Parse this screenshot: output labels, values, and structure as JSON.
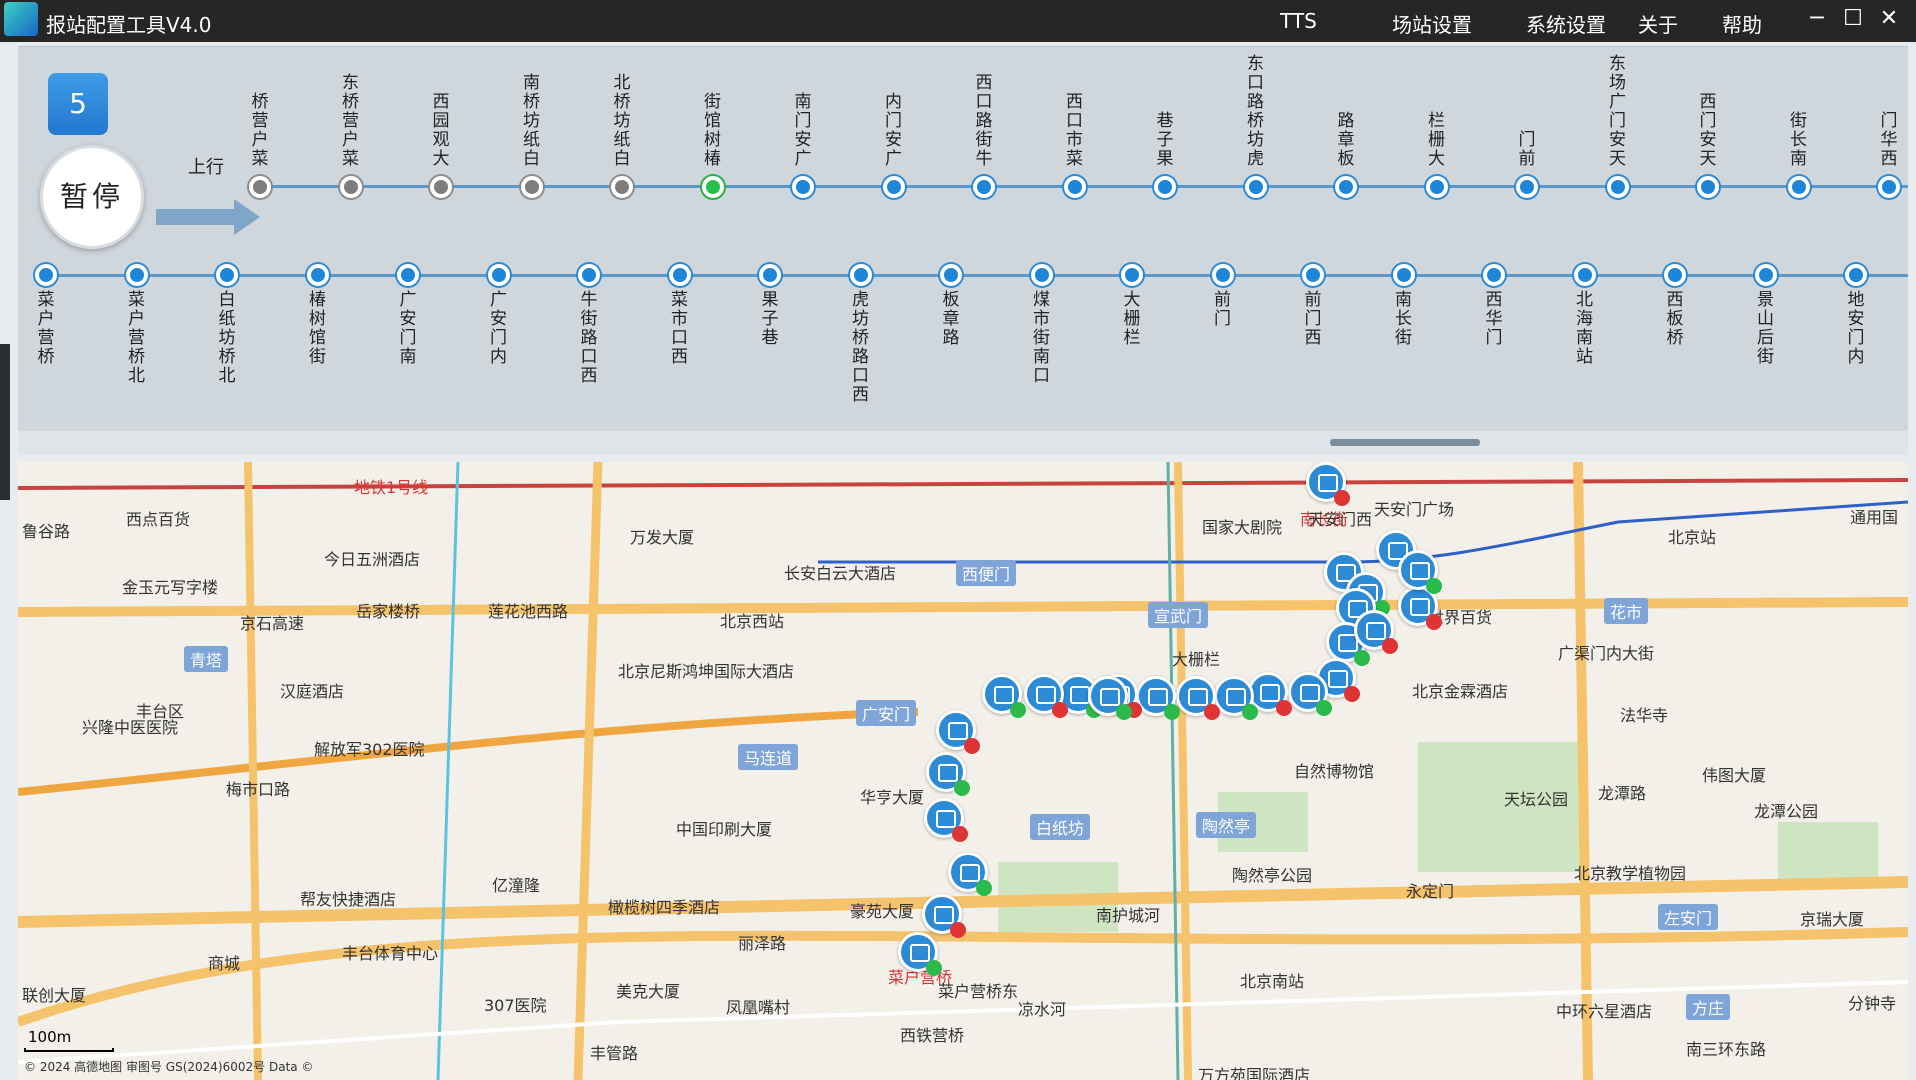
{
  "app": {
    "title": "报站配置工具V4.0"
  },
  "menu": {
    "tts": "TTS",
    "station": "场站设置",
    "system": "系统设置",
    "about": "关于",
    "help": "帮助"
  },
  "window": {
    "minimize": "─",
    "maximize": "☐",
    "close": "✕"
  },
  "route": {
    "number": "5",
    "pause_label": "暂停",
    "direction": "上行"
  },
  "upper_stations": [
    {
      "name": "桥营户菜",
      "state": "grey"
    },
    {
      "name": "东桥营户菜",
      "state": "grey"
    },
    {
      "name": "西园观大",
      "state": "grey"
    },
    {
      "name": "南桥坊纸白",
      "state": "grey"
    },
    {
      "name": "北桥坊纸白",
      "state": "grey"
    },
    {
      "name": "街馆树椿",
      "state": "current"
    },
    {
      "name": "南门安广",
      "state": "blue"
    },
    {
      "name": "内门安广",
      "state": "blue"
    },
    {
      "name": "西口路街牛",
      "state": "blue"
    },
    {
      "name": "西口市菜",
      "state": "blue"
    },
    {
      "name": "巷子果",
      "state": "blue"
    },
    {
      "name": "东口路桥坊虎",
      "state": "blue"
    },
    {
      "name": "路章板",
      "state": "blue"
    },
    {
      "name": "栏栅大",
      "state": "blue"
    },
    {
      "name": "门前",
      "state": "blue"
    },
    {
      "name": "东场广门安天",
      "state": "blue"
    },
    {
      "name": "西门安天",
      "state": "blue"
    },
    {
      "name": "街长南",
      "state": "blue"
    },
    {
      "name": "门华西",
      "state": "blue"
    }
  ],
  "lower_stations": [
    "菜户营桥",
    "菜户营桥北",
    "白纸坊桥北",
    "椿树馆街",
    "广安门南",
    "广安门内",
    "牛街路口西",
    "菜市口西",
    "果子巷",
    "虎坊桥路口西",
    "板章路",
    "煤市街南口",
    "大栅栏",
    "前门",
    "前门西",
    "南长街",
    "西华门",
    "北海南站",
    "西板桥",
    "景山后街",
    "地安门内"
  ],
  "map": {
    "labels": [
      {
        "text": "地铁1号线",
        "style": "red"
      },
      {
        "text": "西点百货",
        "style": ""
      },
      {
        "text": "鲁谷路",
        "style": ""
      },
      {
        "text": "万发大厦",
        "style": ""
      },
      {
        "text": "今日五洲酒店",
        "style": ""
      },
      {
        "text": "金玉元写字楼",
        "style": ""
      },
      {
        "text": "长安白云大酒店",
        "style": ""
      },
      {
        "text": "西便门",
        "style": "bluebox"
      },
      {
        "text": "国家大剧院",
        "style": ""
      },
      {
        "text": "天安门广场",
        "style": ""
      },
      {
        "text": "北京站",
        "style": ""
      },
      {
        "text": "通用国",
        "style": ""
      },
      {
        "text": "京石高速",
        "style": ""
      },
      {
        "text": "岳家楼桥",
        "style": ""
      },
      {
        "text": "莲花池西路",
        "style": ""
      },
      {
        "text": "北京西站",
        "style": ""
      },
      {
        "text": "宣武门",
        "style": "bluebox"
      },
      {
        "text": "新世界百货",
        "style": ""
      },
      {
        "text": "花市",
        "style": "bluebox"
      },
      {
        "text": "青塔",
        "style": "bluebox"
      },
      {
        "text": "北京尼斯鸿坤国际大酒店",
        "style": ""
      },
      {
        "text": "广渠门内大街",
        "style": ""
      },
      {
        "text": "汉庭酒店",
        "style": ""
      },
      {
        "text": "丰台区",
        "style": ""
      },
      {
        "text": "兴隆中医医院",
        "style": ""
      },
      {
        "text": "广安门",
        "style": "bluebox"
      },
      {
        "text": "北京金霖酒店",
        "style": ""
      },
      {
        "text": "法华寺",
        "style": ""
      },
      {
        "text": "解放军302医院",
        "style": ""
      },
      {
        "text": "马连道",
        "style": "bluebox"
      },
      {
        "text": "自然博物馆",
        "style": ""
      },
      {
        "text": "伟图大厦",
        "style": ""
      },
      {
        "text": "梅市口路",
        "style": ""
      },
      {
        "text": "华亨大厦",
        "style": ""
      },
      {
        "text": "天坛公园",
        "style": ""
      },
      {
        "text": "龙潭路",
        "style": ""
      },
      {
        "text": "中国印刷大厦",
        "style": ""
      },
      {
        "text": "白纸坊",
        "style": "bluebox"
      },
      {
        "text": "陶然亭",
        "style": "bluebox"
      },
      {
        "text": "龙潭公园",
        "style": ""
      },
      {
        "text": "亿潼隆",
        "style": ""
      },
      {
        "text": "陶然亭公园",
        "style": ""
      },
      {
        "text": "北京教学植物园",
        "style": ""
      },
      {
        "text": "帮友快捷酒店",
        "style": ""
      },
      {
        "text": "橄榄树四季酒店",
        "style": ""
      },
      {
        "text": "豪苑大厦",
        "style": ""
      },
      {
        "text": "永定门",
        "style": ""
      },
      {
        "text": "南护城河",
        "style": ""
      },
      {
        "text": "左安门",
        "style": "bluebox"
      },
      {
        "text": "京瑞大厦",
        "style": ""
      },
      {
        "text": "丰台体育中心",
        "style": ""
      },
      {
        "text": "丽泽路",
        "style": ""
      },
      {
        "text": "商城",
        "style": ""
      },
      {
        "text": "北京南站",
        "style": ""
      },
      {
        "text": "联创大厦",
        "style": ""
      },
      {
        "text": "美克大厦",
        "style": ""
      },
      {
        "text": "307医院",
        "style": ""
      },
      {
        "text": "凤凰嘴村",
        "style": ""
      },
      {
        "text": "中环六星酒店",
        "style": ""
      },
      {
        "text": "方庄",
        "style": "bluebox"
      },
      {
        "text": "分钟寺",
        "style": ""
      },
      {
        "text": "西铁营桥",
        "style": ""
      },
      {
        "text": "凉水河",
        "style": ""
      },
      {
        "text": "丰管路",
        "style": ""
      },
      {
        "text": "万方苑国际酒店",
        "style": ""
      },
      {
        "text": "南三环东路",
        "style": ""
      },
      {
        "text": "菜户营桥",
        "style": "red"
      },
      {
        "text": "菜户营桥东",
        "style": ""
      },
      {
        "text": "大栅栏",
        "style": ""
      },
      {
        "text": "南长街",
        "style": "red"
      },
      {
        "text": "天安门西",
        "style": ""
      }
    ],
    "bus_markers": 26,
    "scale": "100m",
    "credit": "© 2024 高德地图 审图号 GS(2024)6002号 Data ©"
  }
}
